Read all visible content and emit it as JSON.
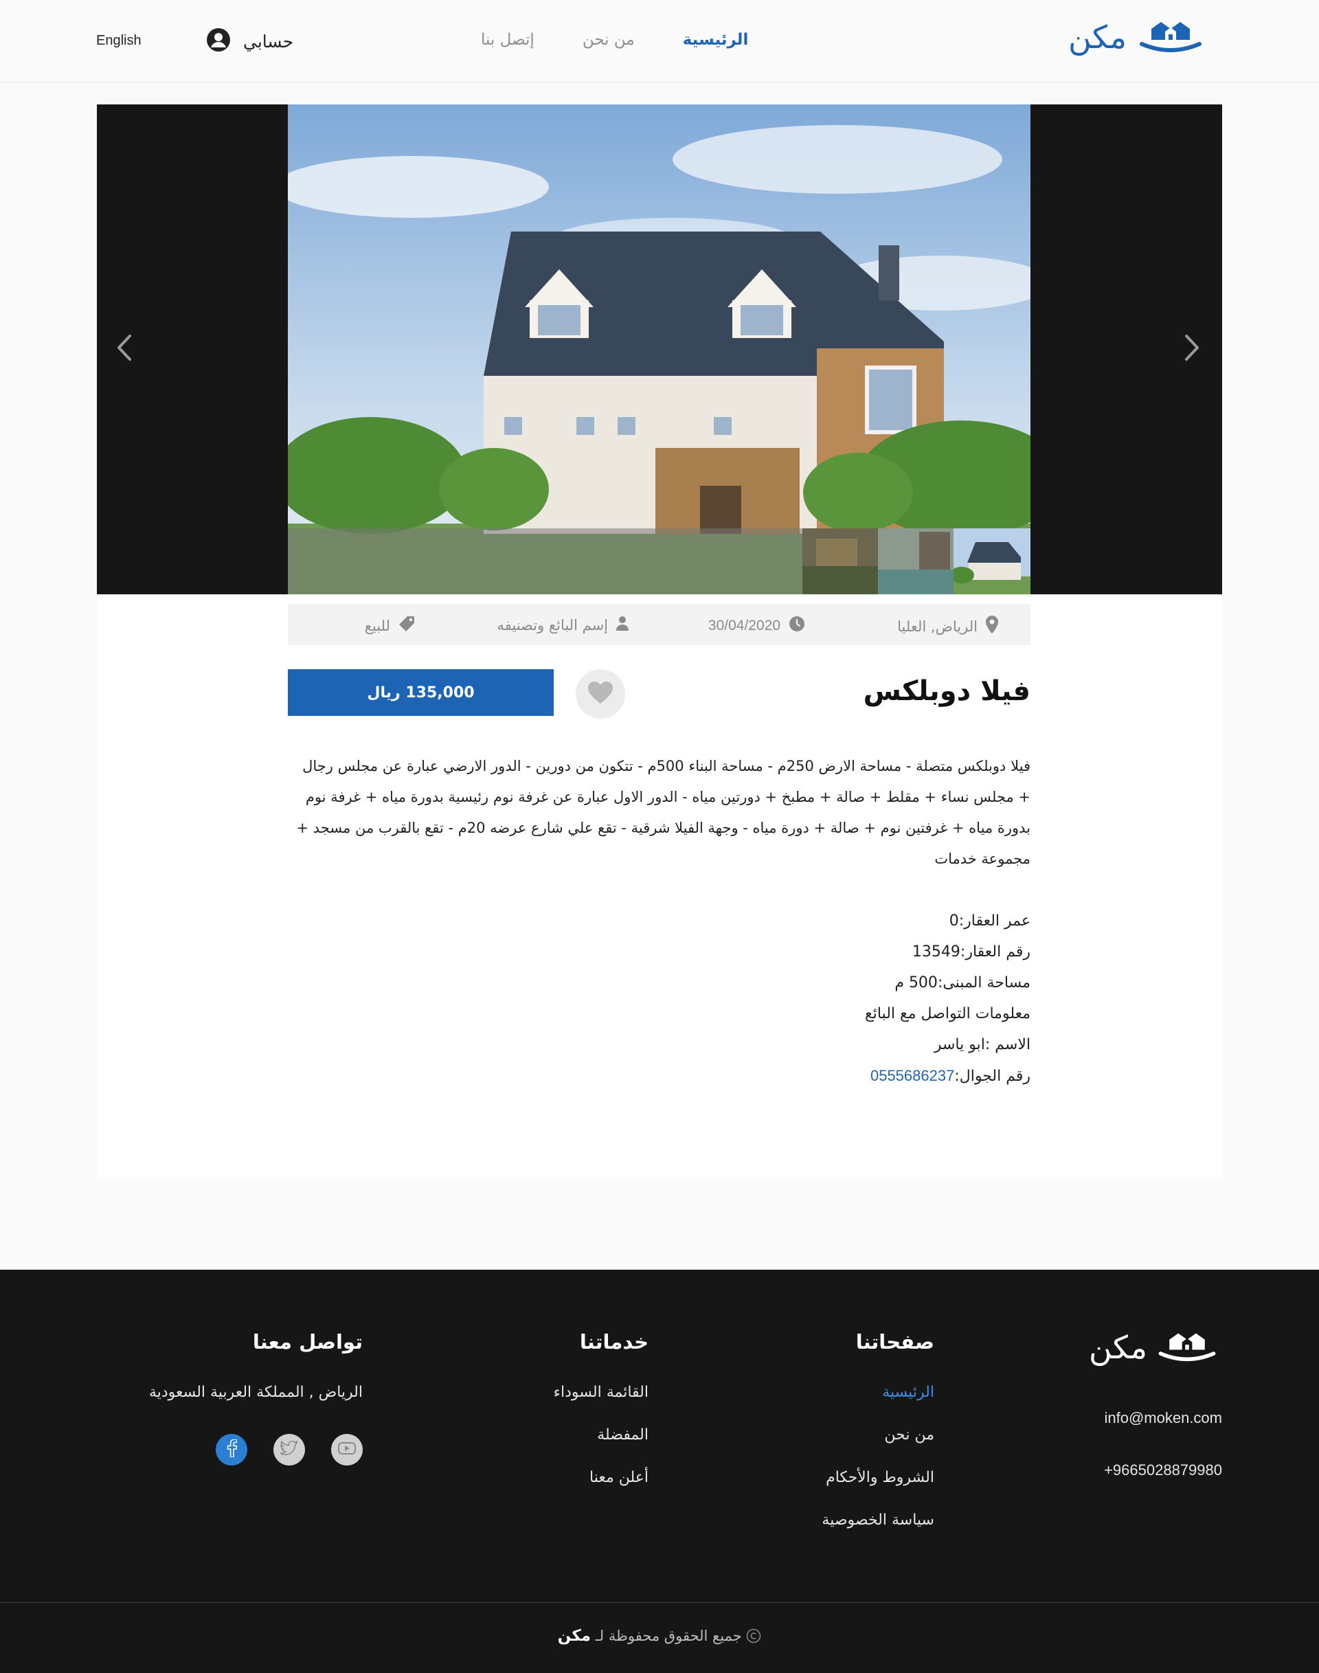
{
  "header": {
    "language_link": "English",
    "account_label": "حسابي",
    "nav": [
      "الرئيسية",
      "من نحن",
      "إتصل بنا"
    ],
    "brand": "مكن"
  },
  "listing": {
    "location": "الرياض, العليا",
    "date": "30/04/2020",
    "seller": "إسم البائع وتصنيفه",
    "status": "للبيع",
    "title": "فيلا دوبلكس",
    "price": "135,000 ريال",
    "description": "فيلا دوبلكس متصلة - مساحة الارض 250م - مساحة البناء 500م - تتكون من دورين - الدور الارضي عبارة عن مجلس رجال + مجلس نساء + مقلط + صالة + مطبخ + دورتين مياه - الدور الاول عبارة عن غرفة نوم رئيسية بدورة مياه + غرفة نوم بدورة مياه + غرفتين نوم + صالة + دورة مياه - وجهة الفيلا شرقية - تقع علي شارع عرضه 20م - تقع بالقرب من مسجد + مجموعة خدمات",
    "details": [
      "عمر العقار:0",
      "رقم العقار:13549",
      "مساحة المبنى:500 م"
    ],
    "contact_heading": "معلومات التواصل مع البائع",
    "contact_name": "الاسم :ابو ياسر",
    "contact_phone_label": "رقم الجوال:",
    "contact_phone": "0555686237"
  },
  "footer": {
    "brand": "مكن",
    "email": "info@moken.com",
    "phone": "+9665028879980",
    "pages": {
      "heading": "صفحاتنا",
      "links": [
        "الرئيسية",
        "من نحن",
        "الشروط والأحكام",
        "سياسة الخصوصية"
      ]
    },
    "services": {
      "heading": "خدماتنا",
      "links": [
        "القائمة السوداء",
        "المفضلة",
        "أعلن معنا"
      ]
    },
    "contact": {
      "heading": "تواصل معنا",
      "address": "الرياض , المملكة العربية السعودية"
    },
    "socials": [
      "facebook-icon",
      "twitter-icon",
      "youtube-icon"
    ],
    "copyright_text": "جميع الحقوق محفوظة لـ",
    "copyright_brand": "مكن"
  },
  "colors": {
    "accent": "#1d64b4",
    "footer_bg": "#161616",
    "facebook": "#2a7fd4"
  },
  "icons": [
    "user-circle-icon",
    "house-logo-icon",
    "map-pin-icon",
    "clock-icon",
    "user-icon",
    "tag-icon",
    "heart-icon",
    "chevron-left-icon",
    "chevron-right-icon",
    "copyright-icon"
  ]
}
